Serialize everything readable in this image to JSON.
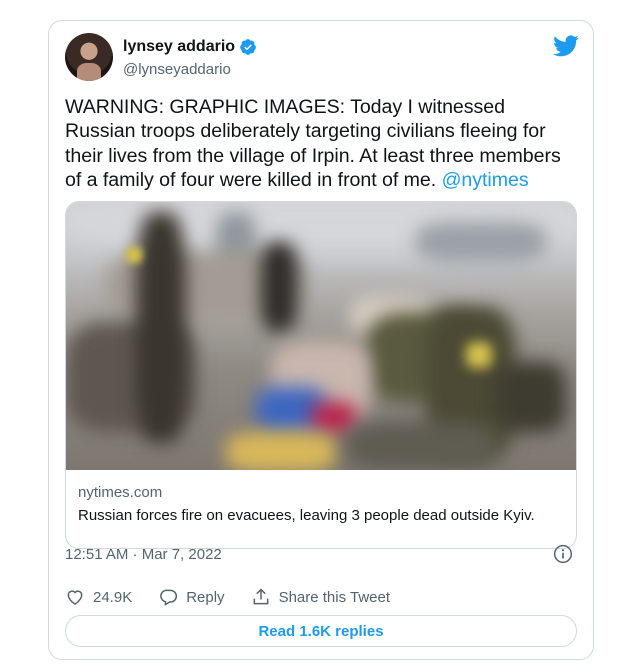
{
  "author": {
    "display_name": "lynsey addario",
    "handle": "@lynseyaddario",
    "verified": true
  },
  "tweet": {
    "text": "WARNING: GRAPHIC IMAGES: Today I witnessed Russian troops deliberately targeting civilians fleeing for their lives from the village of Irpin. At least three members of a family of four were killed in front of me. ",
    "mention": "@nytimes"
  },
  "link_card": {
    "domain": "nytimes.com",
    "title": "Russian forces fire on evacuees, leaving 3 people dead outside Kyiv."
  },
  "meta": {
    "timestamp": "12:51 AM · Mar 7, 2022"
  },
  "actions": {
    "likes": "24.9K",
    "reply_label": "Reply",
    "share_label": "Share this Tweet"
  },
  "read_replies_label": "Read 1.6K replies",
  "colors": {
    "accent": "#1d9bf0",
    "text_primary": "#0f1419",
    "text_secondary": "#536471",
    "border": "#cfd9de"
  },
  "icons": [
    "verified-badge-icon",
    "twitter-bird-icon",
    "info-icon",
    "heart-icon",
    "reply-icon",
    "share-icon"
  ]
}
